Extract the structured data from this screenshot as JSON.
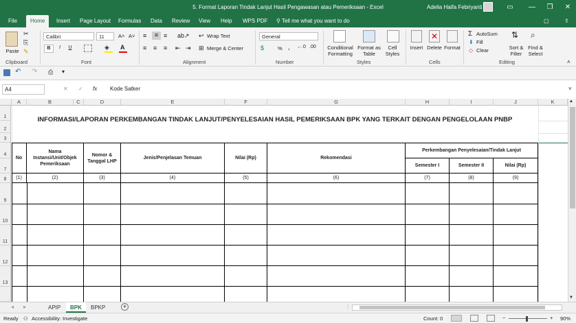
{
  "window": {
    "title": "5. Format Laporan Tindak Lanjut Hasil Pengawasan atau Pemeriksaan  -  Excel",
    "user": "Adelia Haifa Febriyanti",
    "minimize": "—",
    "restore": "❐",
    "close": "✕"
  },
  "tabs": [
    "File",
    "Home",
    "Insert",
    "Page Layout",
    "Formulas",
    "Data",
    "Review",
    "View",
    "Help",
    "WPS PDF"
  ],
  "tell_me": "Tell me what you want to do",
  "ribbon": {
    "clipboard": {
      "label": "Clipboard",
      "paste": "Paste"
    },
    "font": {
      "label": "Font",
      "name": "Calibri",
      "size": "11",
      "grow": "A˄",
      "shrink": "A˅",
      "bold": "B",
      "italic": "I",
      "underline": "U"
    },
    "alignment": {
      "label": "Alignment",
      "wrap": "Wrap Text",
      "merge": "Merge & Center"
    },
    "number": {
      "label": "Number",
      "format": "General",
      "percent": "%",
      "comma": ","
    },
    "styles": {
      "label": "Styles",
      "conditional": "Conditional Formatting",
      "format_table": "Format as Table",
      "cell_styles": "Cell Styles"
    },
    "cells": {
      "label": "Cells",
      "insert": "Insert",
      "delete": "Delete",
      "format": "Format"
    },
    "editing": {
      "label": "Editing",
      "autosum": "AutoSum",
      "fill": "Fill",
      "clear": "Clear",
      "sort": "Sort & Filter",
      "find": "Find & Select"
    }
  },
  "formula_bar": {
    "name_box": "A4",
    "fx": "fx",
    "content": "Kode Satker"
  },
  "columns": [
    "A",
    "B",
    "C",
    "D",
    "E",
    "F",
    "G",
    "H",
    "I",
    "J",
    "K"
  ],
  "rows": [
    "1",
    "2",
    "3",
    "4",
    "7",
    "8",
    "9",
    "10",
    "11",
    "12",
    "13"
  ],
  "sheet": {
    "title": "INFORMASI/LAPORAN PERKEMBANGAN TINDAK LANJUT/PENYELESAIAN HASIL PEMERIKSAAN BPK YANG TERKAIT DENGAN PENGELOLAAN PNBP",
    "headers": {
      "no": "No",
      "nama": "Nama Instansi/Unit/Objek Pemeriksaan",
      "nomor": "Nomor & Tanggal LHP",
      "jenis": "Jenis/Penjelasan Temuan",
      "nilai": "Nilai (Rp)",
      "rekomendasi": "Rekomendasi",
      "perkembangan": "Perkembangan Penyelesaian/Tindak Lanjut",
      "sem1": "Semester I",
      "sem2": "Semester II",
      "nilai2": "Nilai (Rp)"
    },
    "numbers": [
      "(1)",
      "(2)",
      "(3)",
      "(4)",
      "(5)",
      "(6)",
      "(7)",
      "(8)",
      "(9)"
    ]
  },
  "sheet_tabs": [
    "APIP",
    "BPK",
    "BPKP"
  ],
  "active_sheet": "BPK",
  "status": {
    "ready": "Ready",
    "accessibility": "Accessibility: Investigate",
    "count": "Count: 0",
    "zoom": "90%"
  },
  "colors": {
    "brand": "#217346"
  }
}
